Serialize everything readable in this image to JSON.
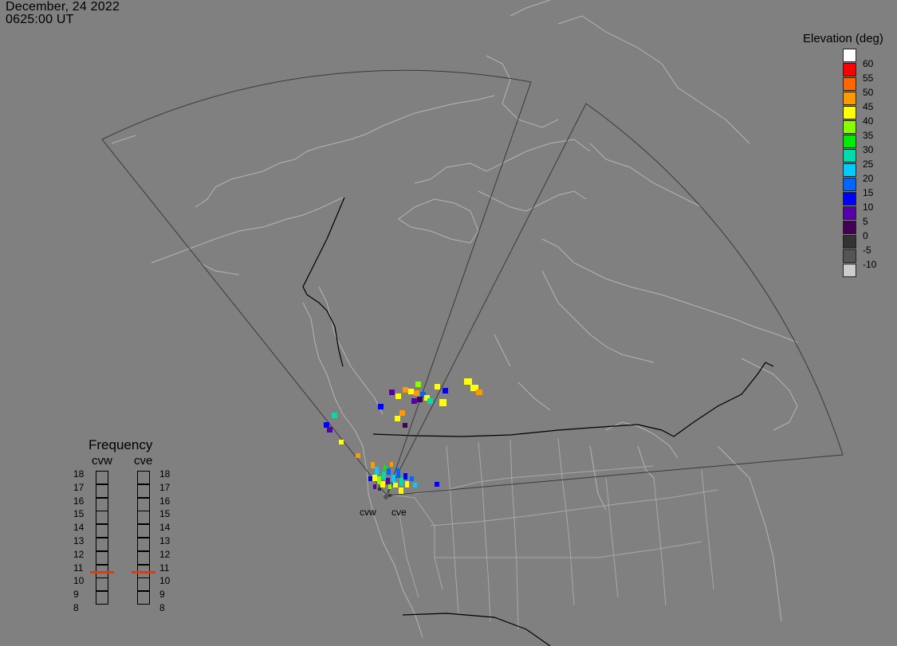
{
  "header": {
    "date": "December, 24 2022",
    "time": "0625:00 UT"
  },
  "legend": {
    "title": "Elevation (deg)",
    "levels": [
      {
        "label": "60",
        "color": "#ffffff"
      },
      {
        "label": "55",
        "color": "#ff0000"
      },
      {
        "label": "50",
        "color": "#ff6600"
      },
      {
        "label": "45",
        "color": "#ff9900"
      },
      {
        "label": "40",
        "color": "#ffff00"
      },
      {
        "label": "35",
        "color": "#88ff00"
      },
      {
        "label": "30",
        "color": "#00ee00"
      },
      {
        "label": "25",
        "color": "#00ddaa"
      },
      {
        "label": "20",
        "color": "#00ccff"
      },
      {
        "label": "15",
        "color": "#0066ff"
      },
      {
        "label": "10",
        "color": "#0000ff"
      },
      {
        "label": "5",
        "color": "#5500aa"
      },
      {
        "label": "0",
        "color": "#440055"
      },
      {
        "label": "-5",
        "color": "#333333"
      },
      {
        "label": "-10",
        "color": "#555555"
      },
      {
        "label": "",
        "color": "#cccccc"
      }
    ]
  },
  "frequency": {
    "title": "Frequency",
    "radars": [
      "cvw",
      "cve"
    ],
    "scale": [
      "18",
      "17",
      "16",
      "15",
      "14",
      "13",
      "12",
      "11",
      "10",
      "9",
      "8"
    ],
    "current_mhz": [
      11,
      11
    ]
  },
  "sites": [
    {
      "name": "cvw"
    },
    {
      "name": "cve"
    }
  ]
}
